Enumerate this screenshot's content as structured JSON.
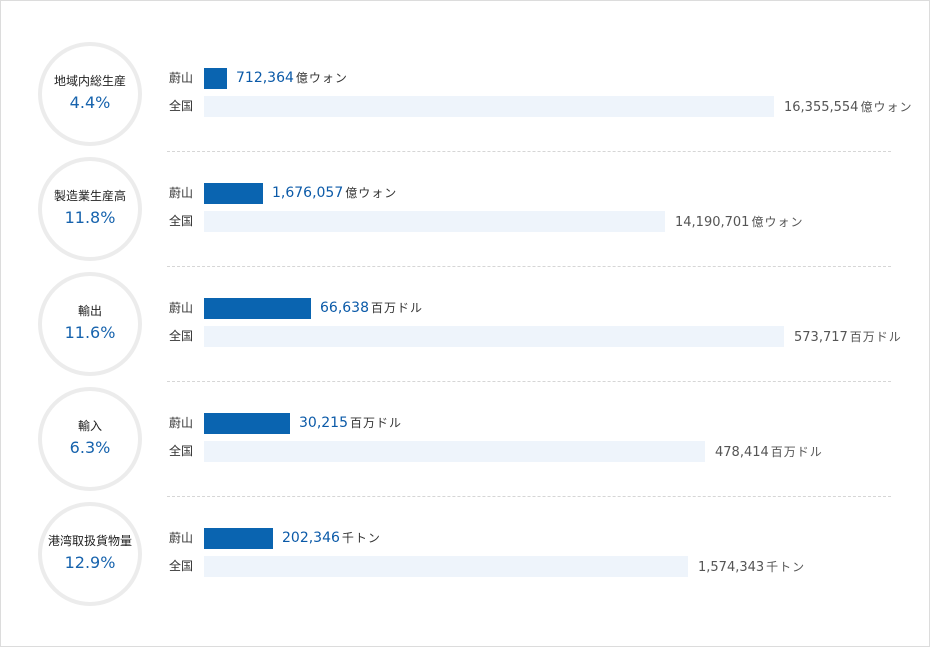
{
  "chart_data": {
    "type": "bar",
    "colors": {
      "local": "#0a64b0",
      "national": "#eef4fb",
      "accent_text": "#1763ad"
    },
    "local_label": "蔚山",
    "national_label": "全国",
    "items": [
      {
        "label": "地域内総生産",
        "share": "4.4%",
        "local_value": 712364,
        "local_text": "712,364",
        "local_unit": "億ウォン",
        "national_value": 16355554,
        "national_text": "16,355,554",
        "national_unit": "億ウォン"
      },
      {
        "label": "製造業生産高",
        "share": "11.8%",
        "local_value": 1676057,
        "local_text": "1,676,057",
        "local_unit": "億ウォン",
        "national_value": 14190701,
        "national_text": "14,190,701",
        "national_unit": "億ウォン"
      },
      {
        "label": "輸出",
        "share": "11.6%",
        "local_value": 66638,
        "local_text": "66,638",
        "local_unit": "百万ドル",
        "national_value": 573717,
        "national_text": "573,717",
        "national_unit": "百万ドル"
      },
      {
        "label": "輸入",
        "share": "6.3%",
        "local_value": 30215,
        "local_text": "30,215",
        "local_unit": "百万ドル",
        "national_value": 478414,
        "national_text": "478,414",
        "national_unit": "百万ドル"
      },
      {
        "label": "港湾取扱貨物量",
        "share": "12.9%",
        "local_value": 202346,
        "local_text": "202,346",
        "local_unit": "千トン",
        "national_value": 1574343,
        "national_text": "1,574,343",
        "national_unit": "千トン"
      }
    ]
  }
}
